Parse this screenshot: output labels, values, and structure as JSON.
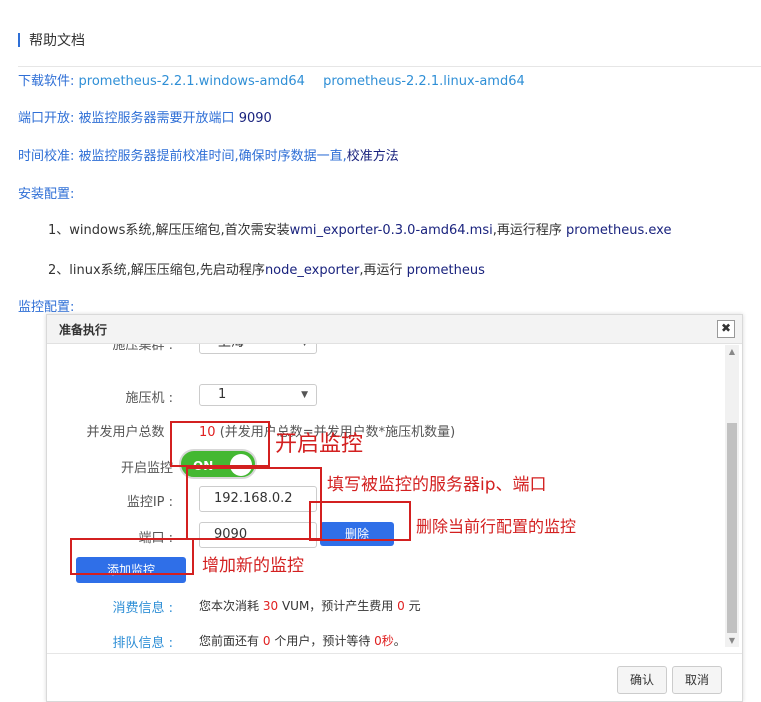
{
  "section": {
    "title": "帮助文档"
  },
  "download": {
    "label": "下载软件:",
    "windows_link": "prometheus-2.2.1.windows-amd64",
    "linux_link": "prometheus-2.2.1.linux-amd64"
  },
  "port": {
    "label": "端口开放:",
    "text": "被监控服务器需要开放端口",
    "value": "9090"
  },
  "time_sync": {
    "label": "时间校准:",
    "text": "被监控服务器提前校准时间,确保时序数据一直,",
    "link": "校准方法"
  },
  "install": {
    "label": "安装配置:",
    "step1_prefix": "1、windows系统,解压压缩包,首次需安装",
    "step1_file": "wmi_exporter-0.3.0-amd64.msi",
    "step1_mid": ",再运行程序",
    "step1_exe": " prometheus.exe",
    "step2_prefix": "2、linux系统,解压压缩包,先启动程序",
    "step2_file": "node_exporter",
    "step2_mid": ",再运行",
    "step2_exe": " prometheus"
  },
  "monitor_label": "监控配置:",
  "dialog": {
    "title": "准备执行",
    "close": "✖",
    "cluster_label": "施压集群 :",
    "cluster_value": "上海",
    "machine_label": "施压机 :",
    "machine_value": "1",
    "concurrent_label": "并发用户总数 :",
    "concurrent_value": "10",
    "concurrent_note": "(并发用户总数=并发用户数*施压机数量)",
    "monitor_toggle_label": "开启监控",
    "toggle_text": "ON",
    "ip_label": "监控IP :",
    "ip_value": "192.168.0.2",
    "port_label": "端口 :",
    "port_value": "9090",
    "delete_button": "删除",
    "add_button": "添加监控",
    "cost_label": "消费信息 :",
    "cost_prefix": "您本次消耗",
    "cost_vum": "30",
    "cost_mid": "VUM，预计产生费用",
    "cost_fee": "0",
    "cost_suffix": "元",
    "queue_label": "排队信息 :",
    "queue_prefix": "您前面还有",
    "queue_users": "0",
    "queue_mid": "个用户，预计等待",
    "queue_wait": "0秒",
    "queue_suffix": "。",
    "confirm_button": "确认",
    "cancel_button": "取消"
  },
  "annotations": {
    "enable": "开启监控",
    "fill_ip": "填写被监控的服务器ip、端口",
    "delete_current": "删除当前行配置的监控",
    "add_new": "增加新的监控"
  }
}
